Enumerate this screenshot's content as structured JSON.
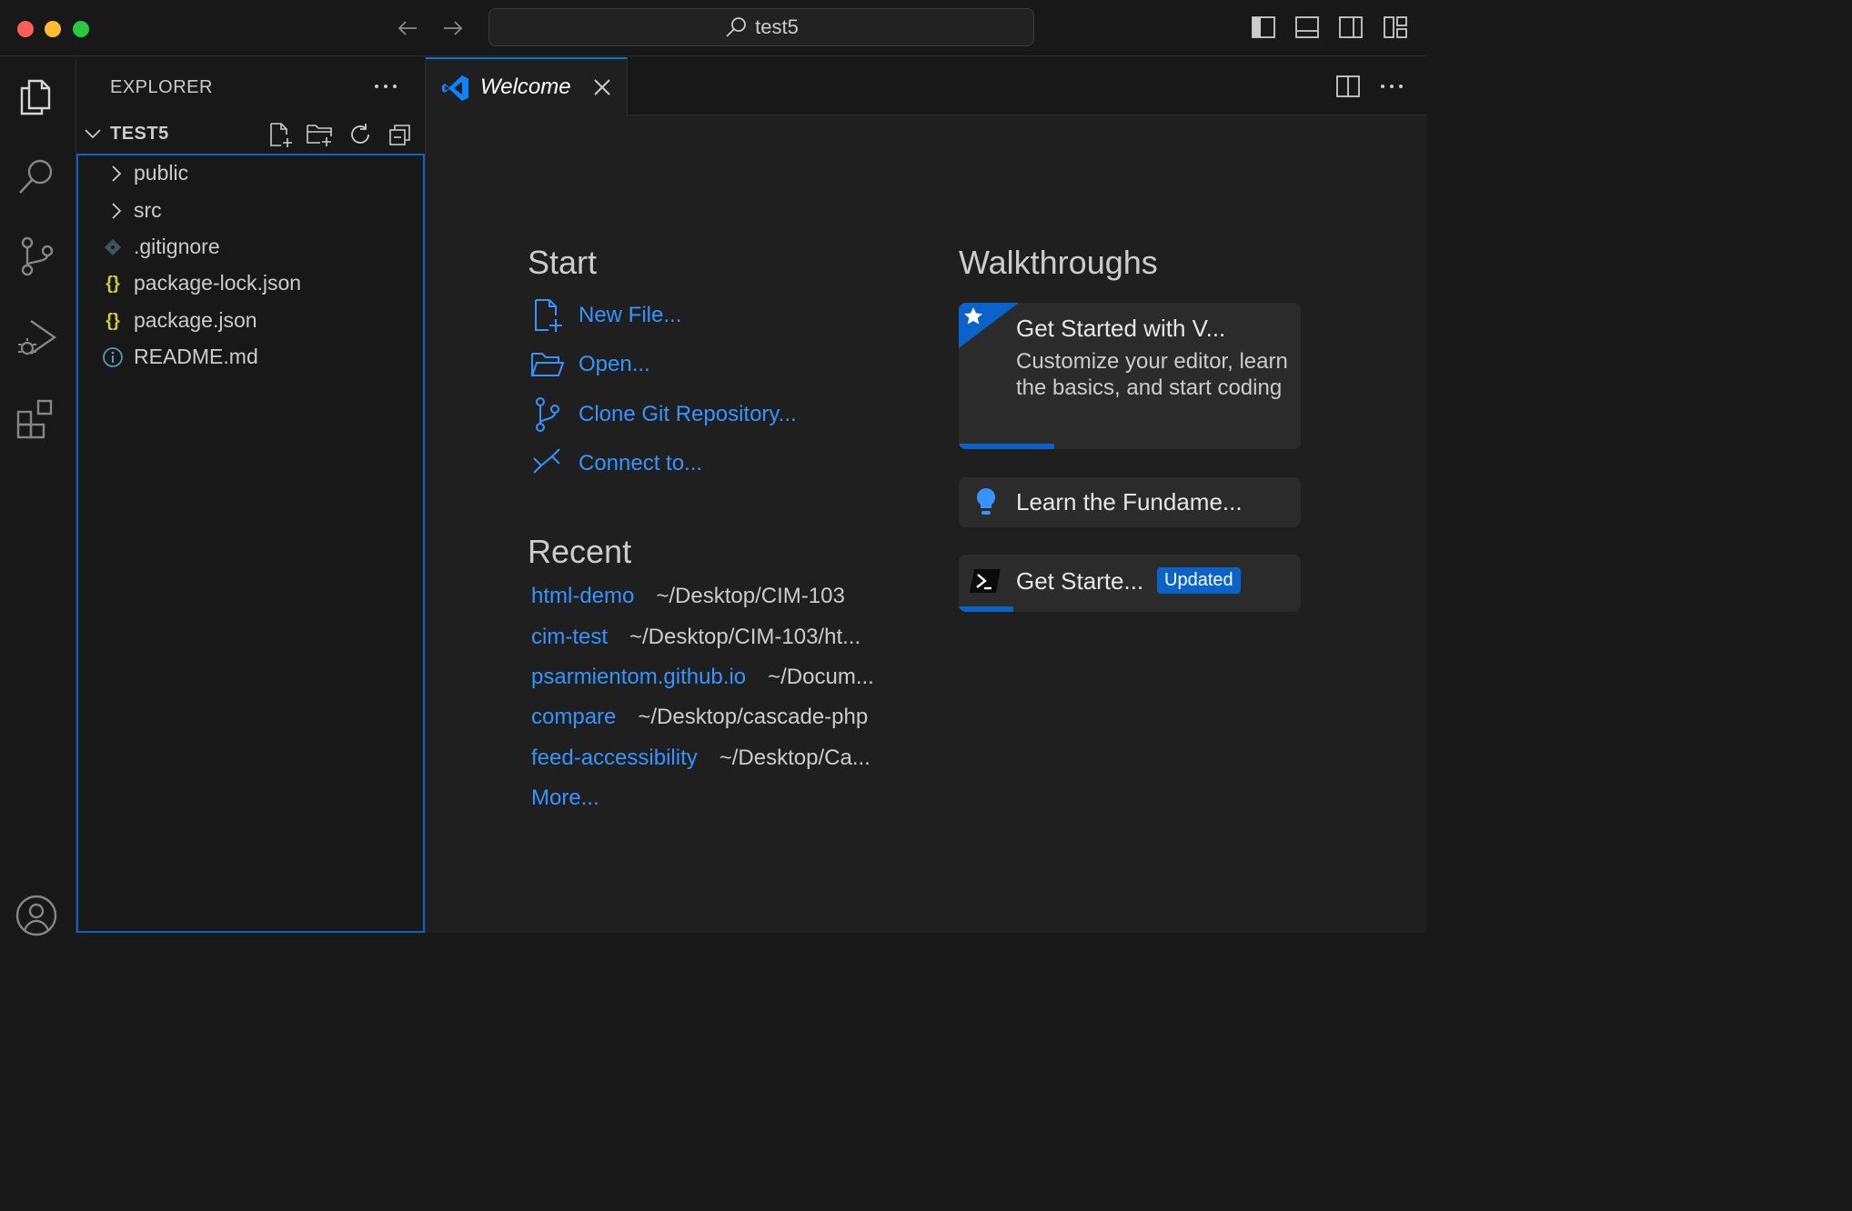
{
  "titlebar": {
    "search_label": "test5"
  },
  "sidebar": {
    "title": "EXPLORER",
    "folder_name": "TEST5",
    "items": [
      {
        "label": "public",
        "type": "folder"
      },
      {
        "label": "src",
        "type": "folder"
      },
      {
        "label": ".gitignore",
        "type": "git-file"
      },
      {
        "label": "package-lock.json",
        "type": "json-file"
      },
      {
        "label": "package.json",
        "type": "json-file"
      },
      {
        "label": "README.md",
        "type": "info-file"
      }
    ]
  },
  "editor": {
    "tab_label": "Welcome",
    "start": {
      "title": "Start",
      "items": [
        {
          "label": "New File...",
          "icon": "new-file-icon"
        },
        {
          "label": "Open...",
          "icon": "folder-open-icon"
        },
        {
          "label": "Clone Git Repository...",
          "icon": "source-control-icon"
        },
        {
          "label": "Connect to...",
          "icon": "remote-icon"
        }
      ]
    },
    "recent": {
      "title": "Recent",
      "items": [
        {
          "name": "html-demo",
          "path": "~/Desktop/CIM-103"
        },
        {
          "name": "cim-test",
          "path": "~/Desktop/CIM-103/ht..."
        },
        {
          "name": "psarmientom.github.io",
          "path": "~/Docum..."
        },
        {
          "name": "compare",
          "path": "~/Desktop/cascade-php"
        },
        {
          "name": "feed-accessibility",
          "path": "~/Desktop/Ca..."
        }
      ],
      "more_label": "More..."
    },
    "walkthroughs": {
      "title": "Walkthroughs",
      "items": [
        {
          "title": "Get Started with V...",
          "description": "Customize your editor, learn the basics, and start coding",
          "progress": 0.28,
          "icon": "star-icon"
        },
        {
          "title": "Learn the Fundame...",
          "icon": "lightbulb-icon"
        },
        {
          "title": "Get Starte...",
          "badge": "Updated",
          "progress": 0.16,
          "icon": "terminal-icon"
        }
      ]
    }
  },
  "colors": {
    "accent": "#0a63c9",
    "link": "#3794ff",
    "json_icon": "#cbcb41",
    "info_icon": "#519aba"
  }
}
